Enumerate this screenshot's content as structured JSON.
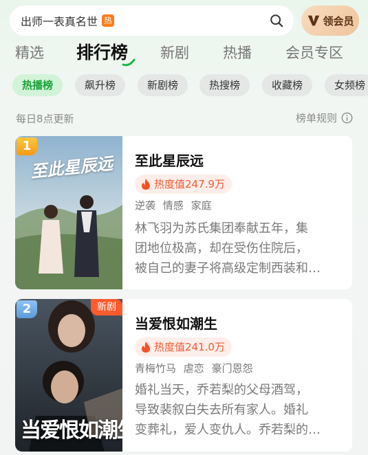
{
  "search": {
    "text": "出师一表真名世",
    "hot_tag": "热",
    "icon": "search-icon"
  },
  "vip_button": {
    "label": "领会员",
    "icon": "vip-v-icon"
  },
  "main_tabs": [
    {
      "label": "精选"
    },
    {
      "label": "排行榜",
      "active": true
    },
    {
      "label": "新剧"
    },
    {
      "label": "热播"
    },
    {
      "label": "会员专区"
    }
  ],
  "chips": [
    {
      "label": "热播榜",
      "active": true
    },
    {
      "label": "飙升榜"
    },
    {
      "label": "新剧榜"
    },
    {
      "label": "热搜榜"
    },
    {
      "label": "收藏榜"
    },
    {
      "label": "女频榜"
    }
  ],
  "info": {
    "update_text": "每日8点更新",
    "rules_text": "榜单规则",
    "rules_icon": "info-icon"
  },
  "cards": [
    {
      "rank": "1",
      "poster_text": "至此星辰远",
      "title": "至此星辰远",
      "heat": "热度值247.9万",
      "tags": [
        "逆袭",
        "情感",
        "家庭"
      ],
      "desc_lines": [
        "林飞羽为苏氏集团奉献五年，集",
        "团地位极高，却在受伤住院后，",
        "被自己的妻子将高级定制西装和…"
      ]
    },
    {
      "rank": "2",
      "badge": "新剧",
      "poster_text": "当爱恨如潮生",
      "title": "当爱恨如潮生",
      "heat": "热度值241.0万",
      "tags": [
        "青梅竹马",
        "虐恋",
        "豪门恩怨"
      ],
      "desc_lines": [
        "婚礼当天，乔若梨的父母酒驾，",
        "导致裴叙白失去所有家人。婚礼",
        "变葬礼，爱人变仇人。乔若梨的…"
      ]
    }
  ],
  "colors": {
    "accent_green": "#18a33a",
    "heat_orange": "#f15a32",
    "new_badge": "#ff5a2d",
    "rank1": "#f5a623",
    "rank2": "#6ea8e0"
  }
}
